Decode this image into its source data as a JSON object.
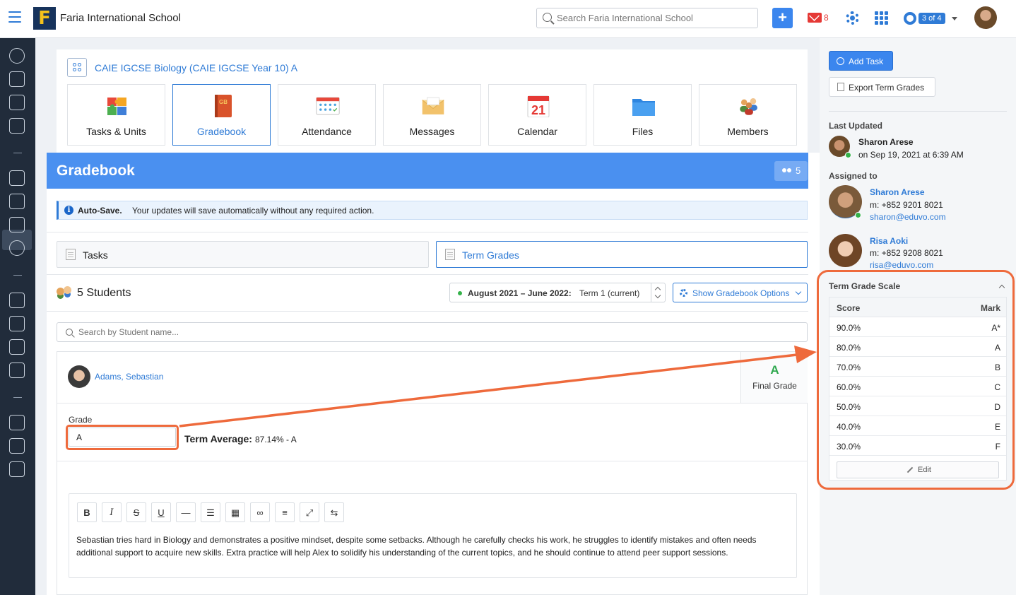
{
  "app": {
    "school_name": "Faria International School",
    "logo_letter": "F",
    "search_placeholder": "Search Faria International School",
    "new_label": "+",
    "mail_count": "8",
    "pager_label": "3 of 4"
  },
  "course": {
    "title": "CAIE IGCSE Biology (CAIE IGCSE Year 10) A",
    "tiles": [
      {
        "label": "Tasks & Units",
        "icon": "puzzle-icon"
      },
      {
        "label": "Gradebook",
        "icon": "gradebook-book-icon",
        "active": true,
        "badge": "GB"
      },
      {
        "label": "Attendance",
        "icon": "attendance-sheet-icon"
      },
      {
        "label": "Messages",
        "icon": "envelope-icon"
      },
      {
        "label": "Calendar",
        "icon": "calendar-icon",
        "day": "21"
      },
      {
        "label": "Files",
        "icon": "folder-icon"
      },
      {
        "label": "Members",
        "icon": "members-group-icon"
      }
    ]
  },
  "gradebook": {
    "title": "Gradebook",
    "member_count": "5",
    "autosave_bold": "Auto-Save.",
    "autosave_text": "Your updates will save automatically without any required action.",
    "tab_tasks": "Tasks",
    "tab_term_grades": "Term Grades",
    "students_title": "5 Students",
    "term_bold": "August 2021 – June 2022:",
    "term_rest": "Term 1 (current)",
    "options_label": "Show Gradebook Options",
    "student_search_placeholder": "Search by Student name..."
  },
  "student": {
    "name": "Adams, Sebastian",
    "final_grade": "A",
    "final_grade_label": "Final Grade",
    "grade_label": "Grade",
    "grade_value": "A",
    "term_average_label": "Term Average:",
    "term_average_value": "87.14% - A",
    "comment": "Sebastian tries hard in Biology and demonstrates a positive mindset, despite some setbacks. Although he carefully checks his work, he struggles to identify mistakes and often needs additional support to acquire new skills. Extra practice will help Alex to solidify his understanding of the current topics, and he should continue to attend peer support sessions."
  },
  "editor_toolbar": [
    {
      "name": "bold-button",
      "glyph": "B"
    },
    {
      "name": "italic-button",
      "glyph": "I"
    },
    {
      "name": "strikethrough-button",
      "glyph": "S"
    },
    {
      "name": "underline-button",
      "glyph": "U"
    },
    {
      "name": "horizontal-rule-button",
      "glyph": "—"
    },
    {
      "name": "bullet-list-button",
      "glyph": "☰"
    },
    {
      "name": "table-button",
      "glyph": "▦"
    },
    {
      "name": "link-button",
      "glyph": "∞"
    },
    {
      "name": "align-button",
      "glyph": "≡"
    },
    {
      "name": "fullscreen-button",
      "glyph": "⤢"
    },
    {
      "name": "direction-button",
      "glyph": "⇆"
    }
  ],
  "right_panel": {
    "add_task": "Add Task",
    "export_term_grades": "Export Term Grades",
    "last_updated_label": "Last Updated",
    "last_updated_name": "Sharon Arese",
    "last_updated_when": "on Sep 19, 2021 at 6:39 AM",
    "assigned_to_label": "Assigned to",
    "assignees": [
      {
        "name": "Sharon Arese",
        "phone": "m: +852 9201 8021",
        "email": "sharon@eduvo.com"
      },
      {
        "name": "Risa Aoki",
        "phone": "m: +852 9208 8021",
        "email": "risa@eduvo.com"
      }
    ],
    "scale_title": "Term Grade Scale",
    "scale_head_score": "Score",
    "scale_head_mark": "Mark",
    "scale": [
      {
        "score": "90.0%",
        "mark": "A*"
      },
      {
        "score": "80.0%",
        "mark": "A"
      },
      {
        "score": "70.0%",
        "mark": "B"
      },
      {
        "score": "60.0%",
        "mark": "C"
      },
      {
        "score": "50.0%",
        "mark": "D"
      },
      {
        "score": "40.0%",
        "mark": "E"
      },
      {
        "score": "30.0%",
        "mark": "F"
      }
    ],
    "edit_label": "Edit"
  },
  "colors": {
    "accent": "#2f7bd6",
    "header_blue": "#4a90f0",
    "rail": "#212c3b",
    "annotation": "#ee6a3c",
    "grade_green": "#2fa84f"
  }
}
